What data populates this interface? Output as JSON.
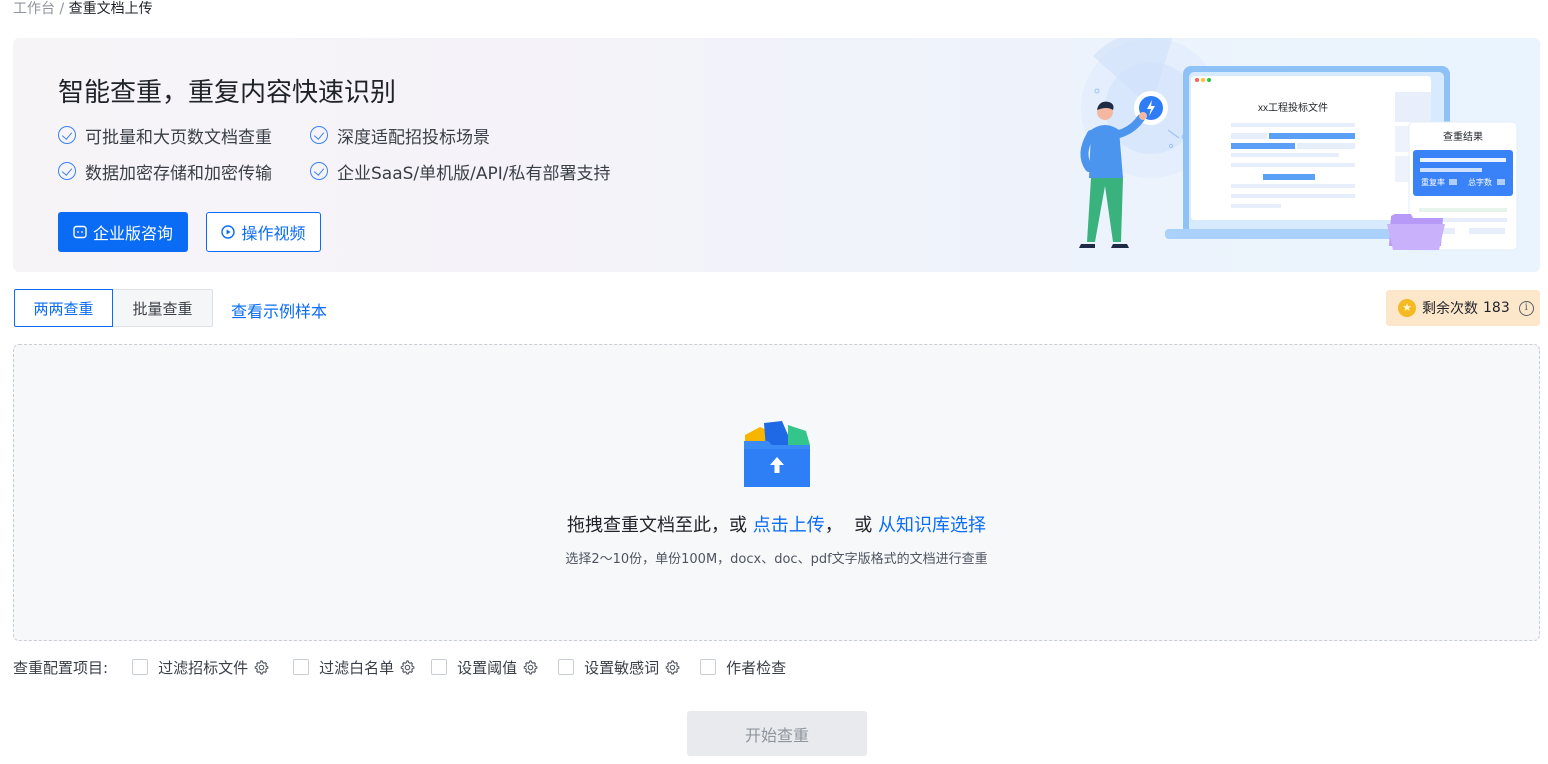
{
  "breadcrumb": {
    "root": "工作台",
    "separator": " / ",
    "current": "查重文档上传"
  },
  "banner": {
    "title": "智能查重，重复内容快速识别",
    "features": [
      "可批量和大页数文档查重",
      "深度适配招投标场景",
      "数据加密存储和加密传输",
      "企业SaaS/单机版/API/私有部署支持"
    ],
    "primary_button": "企业版咨询",
    "secondary_button": "操作视频",
    "illustration": {
      "doc_title": "xx工程投标文件",
      "result_title": "查重结果",
      "result_rate": "重复率",
      "result_words": "总字数"
    }
  },
  "tabs": [
    {
      "label": "两两查重",
      "active": true
    },
    {
      "label": "批量查重",
      "active": false
    }
  ],
  "sample_link": "查看示例样本",
  "quota": {
    "label": "剩余次数",
    "value": "183"
  },
  "dropzone": {
    "text_prefix": "拖拽查重文档至此，或 ",
    "upload_link": "点击上传",
    "text_middle": "，  或 ",
    "library_link": "从知识库选择",
    "hint": "选择2～10份，单份100M，docx、doc、pdf文字版格式的文档进行查重"
  },
  "config": {
    "label": "查重配置项目:",
    "options": [
      {
        "label": "过滤招标文件",
        "checked": false,
        "has_settings": true
      },
      {
        "label": "过滤白名单",
        "checked": false,
        "has_settings": true
      },
      {
        "label": "设置阈值",
        "checked": false,
        "has_settings": true
      },
      {
        "label": "设置敏感词",
        "checked": false,
        "has_settings": true
      },
      {
        "label": "作者检查",
        "checked": false,
        "has_settings": false
      }
    ]
  },
  "start_button": "开始查重",
  "colors": {
    "primary": "#0a6cf5",
    "quota_bg": "#fde7cb",
    "disabled_bg": "#e8eaed"
  }
}
